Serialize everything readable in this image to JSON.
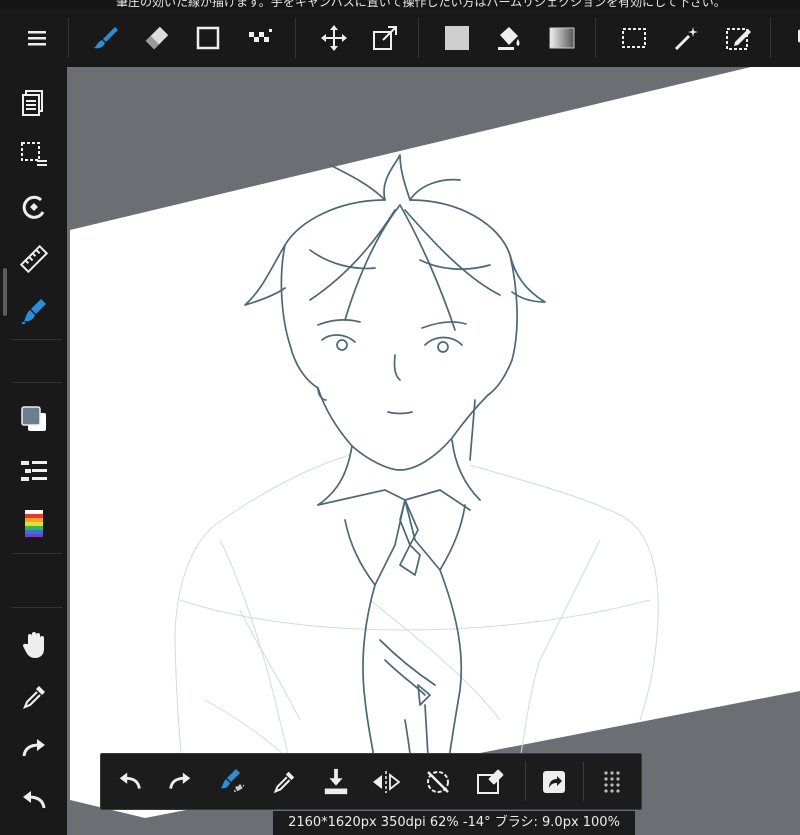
{
  "app": {
    "tip_text": "筆圧の効いた線が描けます。手をキャンバスに置いて操作したい方はパームリジェクションを有効にして下さい。"
  },
  "colors": {
    "accent": "#2a8fd6",
    "toolbar_bg": "#191919",
    "workspace_bg": "#6b6e73",
    "canvas_bg": "#ffffff",
    "line_color": "#4a6878",
    "foreground_color": "#6a8090",
    "background_color": "#ffffff"
  },
  "toolbar": {
    "icons": [
      "menu-icon",
      "brush-icon",
      "eraser-icon",
      "shape-icon",
      "dot-pen-icon",
      "move-icon",
      "transform-icon",
      "fill-color-icon",
      "bucket-icon",
      "gradient-icon",
      "select-rect-icon",
      "magic-wand-icon",
      "select-pen-icon",
      "cube-icon"
    ],
    "selected": "brush-icon"
  },
  "sidebar": {
    "icons": [
      "layers-icon",
      "selection-layer-icon",
      "snap-icon",
      "ruler-icon",
      "brush-settings-icon",
      "color-icon",
      "layer-list-icon",
      "palette-icon",
      "hand-icon",
      "eyedropper-icon",
      "redo-icon",
      "undo-icon"
    ],
    "selected": "brush-settings-icon"
  },
  "quickbar": {
    "icons": [
      "undo-icon",
      "redo-icon",
      "brush-eraser-toggle-icon",
      "eyedropper-icon",
      "save-icon",
      "flip-icon",
      "rotate-reset-icon",
      "clear-icon",
      "share-icon",
      "more-icon"
    ]
  },
  "status": {
    "text": "2160*1620px 350dpi 62% -14° ブラシ: 9.0px 100%"
  }
}
